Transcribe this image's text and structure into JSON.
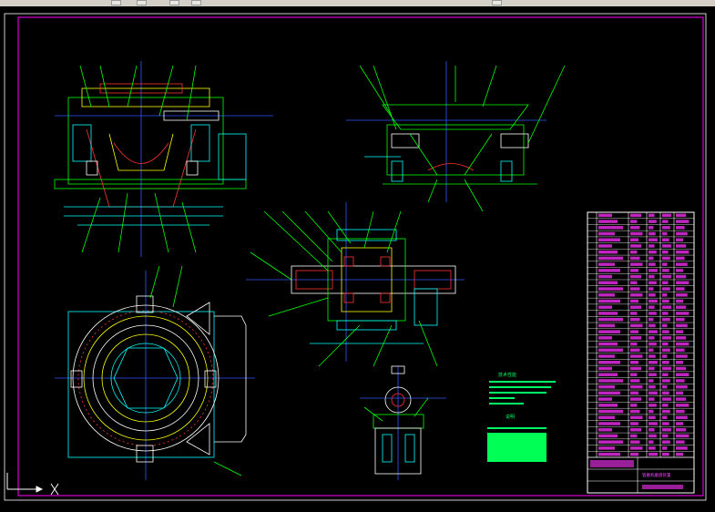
{
  "app": {
    "toolbar": {
      "buttons": [
        "save-icon",
        "print-icon",
        "zoom-icon",
        "pan-icon",
        "help-icon"
      ],
      "colors": {
        "bg": "#d4d0c8"
      }
    }
  },
  "drawing": {
    "colors": {
      "background": "#000000",
      "frame": "#ff00ff",
      "geometry": "#00ff00",
      "centerline": "#3355ff",
      "dimension": "#00ffff",
      "annotation": "#ff33ff",
      "hidden": "#ffff00",
      "section": "#ff3333"
    },
    "notes": {
      "title": "技术性能",
      "subtitle": "说明"
    },
    "title_block": {
      "name": "管磨机磨盘装置",
      "rows": 40
    }
  }
}
